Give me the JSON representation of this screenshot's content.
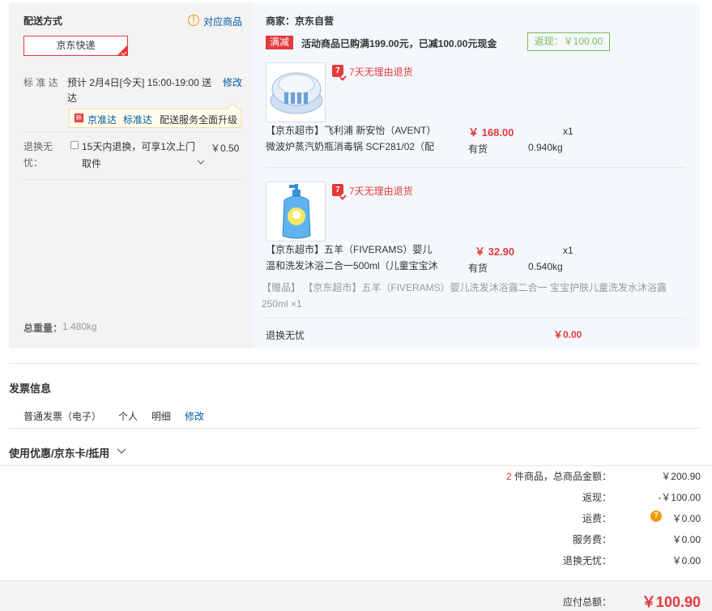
{
  "shipping": {
    "section_title": "配送方式",
    "match_goods_link": "对应商品",
    "selected_method": "京东快递",
    "standard_label": "标 准 达",
    "standard_time": "预计 2月4日[今天] 15:00-19:00 送达",
    "modify_link": "修改",
    "upgrade_tag": "新",
    "upgrade_links": [
      "京准达",
      "标准达"
    ],
    "upgrade_text": "配送服务全面升级",
    "worry_free_label": "退换无忧：",
    "worry_free_line1": "15天内退换，可享1次上门",
    "worry_free_line2": "取件",
    "worry_free_price": "￥0.50",
    "total_weight_label": "总重量：",
    "total_weight_value": "1.480kg"
  },
  "goods": {
    "merchant": "商家：京东自营",
    "promo_tag": "满减",
    "promo_text": "活动商品已购满199.00元，已减100.00元现金",
    "rebate": "返现：￥100.00",
    "items": [
      {
        "return_policy": "7天无理由退货",
        "title": "【京东超市】飞利浦 新安怡（AVENT）微波炉蒸汽奶瓶消毒锅 SCF281/02（配",
        "price": "￥ 168.00",
        "qty": "x1",
        "stock": "有货",
        "weight": "0.940kg"
      },
      {
        "return_policy": "7天无理由退货",
        "title": "【京东超市】五羊（FIVERAMS）婴儿温和洗发沐浴二合一500ml（儿童宝宝沐浴",
        "price": "￥ 32.90",
        "qty": "x1",
        "stock": "有货",
        "weight": "0.540kg"
      }
    ],
    "gift": "【赠品】 【京东超市】五羊（FIVERAMS）婴儿洗发沐浴露二合一 宝宝护肤儿童洗发水沐浴露 250ml ×1",
    "worry_free_label": "退换无忧",
    "worry_free_price": "￥0.00"
  },
  "invoice": {
    "title": "发票信息",
    "type": "普通发票（电子）",
    "person": "个人",
    "detail": "明细",
    "modify": "修改"
  },
  "coupon": {
    "title": "使用优惠/京东卡/抵用"
  },
  "summary": {
    "count": "2",
    "count_suffix": "件商品，总商品金额：",
    "goods_total": "￥200.90",
    "rebate_label": "返现：",
    "rebate_value": "-￥100.00",
    "freight_label": "运费：",
    "freight_value": "￥0.00",
    "service_label": "服务费：",
    "service_value": "￥0.00",
    "worry_label": "退换无忧：",
    "worry_value": "￥0.00",
    "payable_label": "应付总额：",
    "payable_value": "￥100.90"
  },
  "icons": {
    "hint": "exclamation-circle-icon",
    "check": "checkmark-corner-icon",
    "chevron": "chevron-down-icon",
    "help": "question-circle-icon",
    "return": "seven-day-return-icon"
  },
  "colors": {
    "accent": "#e4393c",
    "link": "#005aa0",
    "rebate": "#7abd54",
    "warn": "#f39800"
  }
}
